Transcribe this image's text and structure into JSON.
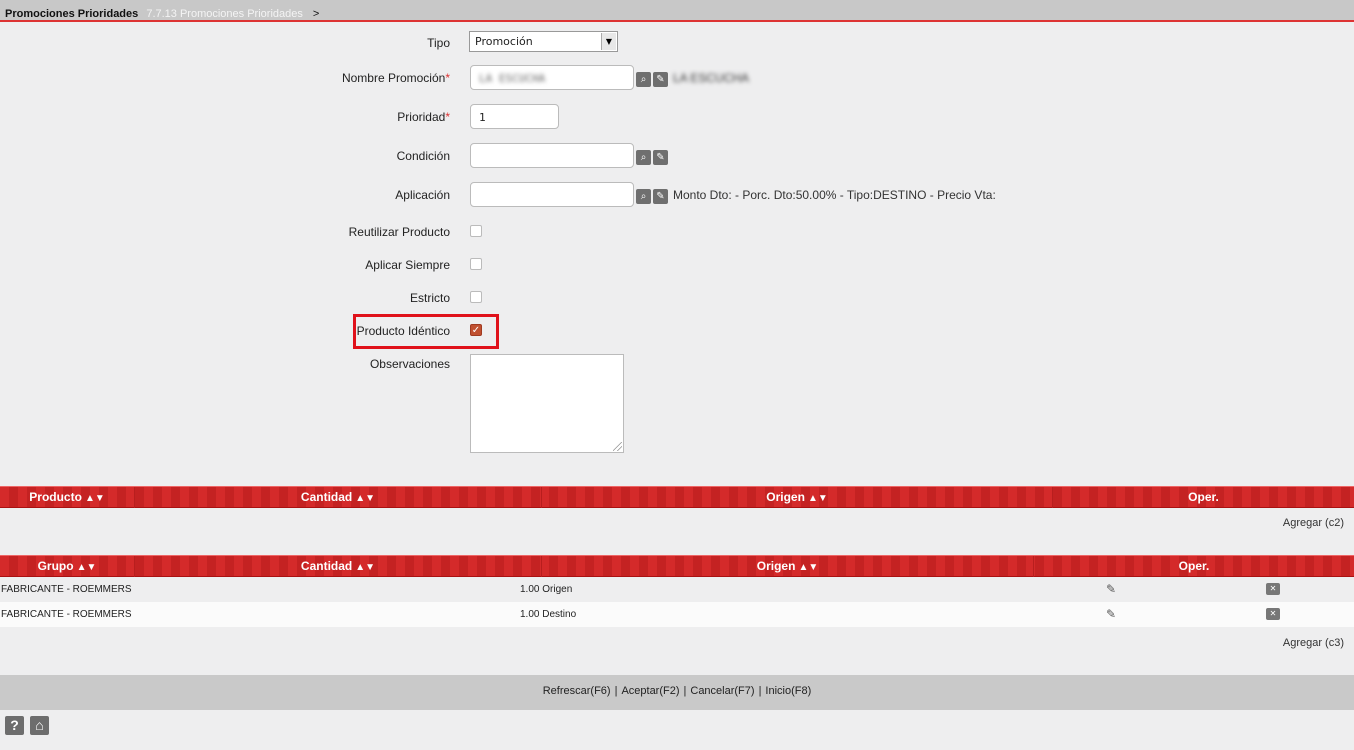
{
  "breadcrumb": {
    "title": "Promociones Prioridades",
    "path": "7.7.13 Promociones Prioridades",
    "separator": ">"
  },
  "form": {
    "tipo": {
      "label": "Tipo",
      "value": "Promoción"
    },
    "nombre": {
      "label": "Nombre Promoción",
      "required": "*",
      "value": "LA ESCUCHA",
      "description": "LA ESCUCHA"
    },
    "prioridad": {
      "label": "Prioridad",
      "required": "*",
      "value": "1"
    },
    "condicion": {
      "label": "Condición",
      "value": ""
    },
    "aplicacion": {
      "label": "Aplicación",
      "value": "",
      "info": "Monto Dto: - Porc. Dto:50.00% - Tipo:DESTINO - Precio Vta:"
    },
    "reutilizar": {
      "label": "Reutilizar Producto",
      "checked": false
    },
    "aplicar_siempre": {
      "label": "Aplicar Siempre",
      "checked": false
    },
    "estricto": {
      "label": "Estricto",
      "checked": false
    },
    "producto_identico": {
      "label": "Producto Idéntico",
      "checked": true
    },
    "observaciones": {
      "label": "Observaciones",
      "value": ""
    }
  },
  "productos_grid": {
    "columns": [
      "Producto",
      "Cantidad",
      "Origen",
      "Oper."
    ],
    "add_label": "Agregar (c2)"
  },
  "grupos_grid": {
    "columns": [
      "Grupo",
      "Cantidad",
      "Origen",
      "Oper."
    ],
    "rows": [
      {
        "grupo": "FABRICANTE - ROEMMERS",
        "cantidad": "1.00",
        "origen": "Origen"
      },
      {
        "grupo": "FABRICANTE - ROEMMERS",
        "cantidad": "1.00",
        "origen": "Destino"
      }
    ],
    "add_label": "Agregar (c3)"
  },
  "footer": {
    "refresh": "Refrescar(F6)",
    "accept": "Aceptar(F2)",
    "cancel": "Cancelar(F7)",
    "home": "Inicio(F8)",
    "separator": "|"
  },
  "icons": {
    "help": "?",
    "sort": "▲▼"
  },
  "colors": {
    "accent": "#d42a2a",
    "highlight": "#e0111b",
    "checkbox_checked": "#c05030"
  }
}
